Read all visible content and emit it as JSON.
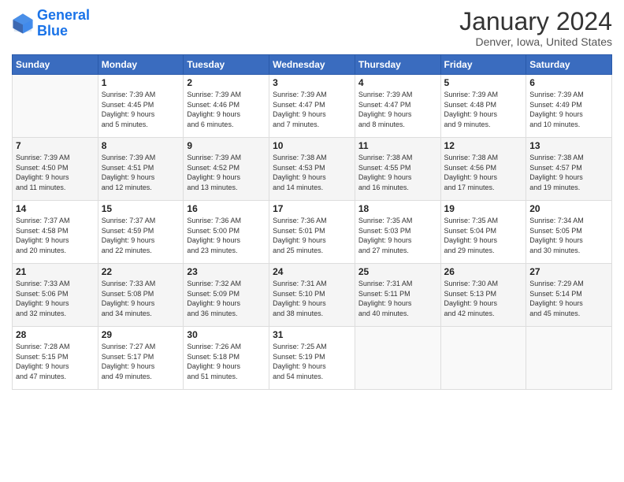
{
  "header": {
    "logo_line1": "General",
    "logo_line2": "Blue",
    "month_title": "January 2024",
    "subtitle": "Denver, Iowa, United States"
  },
  "days_of_week": [
    "Sunday",
    "Monday",
    "Tuesday",
    "Wednesday",
    "Thursday",
    "Friday",
    "Saturday"
  ],
  "weeks": [
    [
      {
        "num": "",
        "info": ""
      },
      {
        "num": "1",
        "info": "Sunrise: 7:39 AM\nSunset: 4:45 PM\nDaylight: 9 hours\nand 5 minutes."
      },
      {
        "num": "2",
        "info": "Sunrise: 7:39 AM\nSunset: 4:46 PM\nDaylight: 9 hours\nand 6 minutes."
      },
      {
        "num": "3",
        "info": "Sunrise: 7:39 AM\nSunset: 4:47 PM\nDaylight: 9 hours\nand 7 minutes."
      },
      {
        "num": "4",
        "info": "Sunrise: 7:39 AM\nSunset: 4:47 PM\nDaylight: 9 hours\nand 8 minutes."
      },
      {
        "num": "5",
        "info": "Sunrise: 7:39 AM\nSunset: 4:48 PM\nDaylight: 9 hours\nand 9 minutes."
      },
      {
        "num": "6",
        "info": "Sunrise: 7:39 AM\nSunset: 4:49 PM\nDaylight: 9 hours\nand 10 minutes."
      }
    ],
    [
      {
        "num": "7",
        "info": "Sunrise: 7:39 AM\nSunset: 4:50 PM\nDaylight: 9 hours\nand 11 minutes."
      },
      {
        "num": "8",
        "info": "Sunrise: 7:39 AM\nSunset: 4:51 PM\nDaylight: 9 hours\nand 12 minutes."
      },
      {
        "num": "9",
        "info": "Sunrise: 7:39 AM\nSunset: 4:52 PM\nDaylight: 9 hours\nand 13 minutes."
      },
      {
        "num": "10",
        "info": "Sunrise: 7:38 AM\nSunset: 4:53 PM\nDaylight: 9 hours\nand 14 minutes."
      },
      {
        "num": "11",
        "info": "Sunrise: 7:38 AM\nSunset: 4:55 PM\nDaylight: 9 hours\nand 16 minutes."
      },
      {
        "num": "12",
        "info": "Sunrise: 7:38 AM\nSunset: 4:56 PM\nDaylight: 9 hours\nand 17 minutes."
      },
      {
        "num": "13",
        "info": "Sunrise: 7:38 AM\nSunset: 4:57 PM\nDaylight: 9 hours\nand 19 minutes."
      }
    ],
    [
      {
        "num": "14",
        "info": "Sunrise: 7:37 AM\nSunset: 4:58 PM\nDaylight: 9 hours\nand 20 minutes."
      },
      {
        "num": "15",
        "info": "Sunrise: 7:37 AM\nSunset: 4:59 PM\nDaylight: 9 hours\nand 22 minutes."
      },
      {
        "num": "16",
        "info": "Sunrise: 7:36 AM\nSunset: 5:00 PM\nDaylight: 9 hours\nand 23 minutes."
      },
      {
        "num": "17",
        "info": "Sunrise: 7:36 AM\nSunset: 5:01 PM\nDaylight: 9 hours\nand 25 minutes."
      },
      {
        "num": "18",
        "info": "Sunrise: 7:35 AM\nSunset: 5:03 PM\nDaylight: 9 hours\nand 27 minutes."
      },
      {
        "num": "19",
        "info": "Sunrise: 7:35 AM\nSunset: 5:04 PM\nDaylight: 9 hours\nand 29 minutes."
      },
      {
        "num": "20",
        "info": "Sunrise: 7:34 AM\nSunset: 5:05 PM\nDaylight: 9 hours\nand 30 minutes."
      }
    ],
    [
      {
        "num": "21",
        "info": "Sunrise: 7:33 AM\nSunset: 5:06 PM\nDaylight: 9 hours\nand 32 minutes."
      },
      {
        "num": "22",
        "info": "Sunrise: 7:33 AM\nSunset: 5:08 PM\nDaylight: 9 hours\nand 34 minutes."
      },
      {
        "num": "23",
        "info": "Sunrise: 7:32 AM\nSunset: 5:09 PM\nDaylight: 9 hours\nand 36 minutes."
      },
      {
        "num": "24",
        "info": "Sunrise: 7:31 AM\nSunset: 5:10 PM\nDaylight: 9 hours\nand 38 minutes."
      },
      {
        "num": "25",
        "info": "Sunrise: 7:31 AM\nSunset: 5:11 PM\nDaylight: 9 hours\nand 40 minutes."
      },
      {
        "num": "26",
        "info": "Sunrise: 7:30 AM\nSunset: 5:13 PM\nDaylight: 9 hours\nand 42 minutes."
      },
      {
        "num": "27",
        "info": "Sunrise: 7:29 AM\nSunset: 5:14 PM\nDaylight: 9 hours\nand 45 minutes."
      }
    ],
    [
      {
        "num": "28",
        "info": "Sunrise: 7:28 AM\nSunset: 5:15 PM\nDaylight: 9 hours\nand 47 minutes."
      },
      {
        "num": "29",
        "info": "Sunrise: 7:27 AM\nSunset: 5:17 PM\nDaylight: 9 hours\nand 49 minutes."
      },
      {
        "num": "30",
        "info": "Sunrise: 7:26 AM\nSunset: 5:18 PM\nDaylight: 9 hours\nand 51 minutes."
      },
      {
        "num": "31",
        "info": "Sunrise: 7:25 AM\nSunset: 5:19 PM\nDaylight: 9 hours\nand 54 minutes."
      },
      {
        "num": "",
        "info": ""
      },
      {
        "num": "",
        "info": ""
      },
      {
        "num": "",
        "info": ""
      }
    ]
  ]
}
